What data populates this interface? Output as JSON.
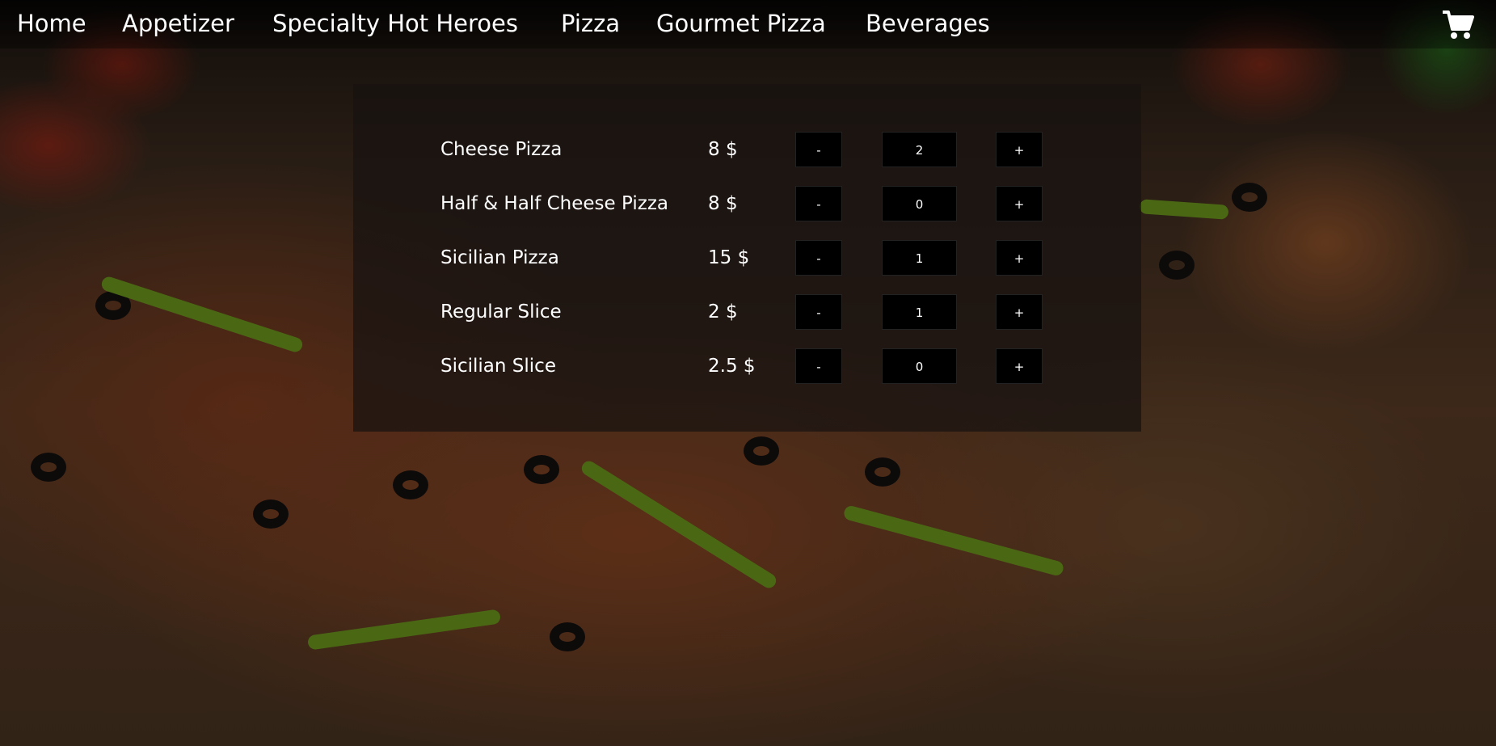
{
  "nav": {
    "items": [
      {
        "label": "Home"
      },
      {
        "label": "Appetizer"
      },
      {
        "label": "Specialty Hot Heroes"
      },
      {
        "label": "Pizza"
      },
      {
        "label": "Gourmet Pizza"
      },
      {
        "label": "Beverages"
      }
    ],
    "cart_icon": "shopping-cart-icon"
  },
  "menu": {
    "items": [
      {
        "name": "Cheese Pizza",
        "price": "8 $",
        "quantity": "2",
        "minus": "-",
        "plus": "+"
      },
      {
        "name": "Half & Half Cheese Pizza",
        "price": "8 $",
        "quantity": "0",
        "minus": "-",
        "plus": "+"
      },
      {
        "name": "Sicilian Pizza",
        "price": "15 $",
        "quantity": "1",
        "minus": "-",
        "plus": "+"
      },
      {
        "name": "Regular Slice",
        "price": "2 $",
        "quantity": "1",
        "minus": "-",
        "plus": "+"
      },
      {
        "name": "Sicilian Slice",
        "price": "2.5 $",
        "quantity": "0",
        "minus": "-",
        "plus": "+"
      }
    ]
  },
  "colors": {
    "text": "#ffffff",
    "button_bg": "#000000",
    "panel_bg": "rgba(24,18,16,0.72)"
  }
}
